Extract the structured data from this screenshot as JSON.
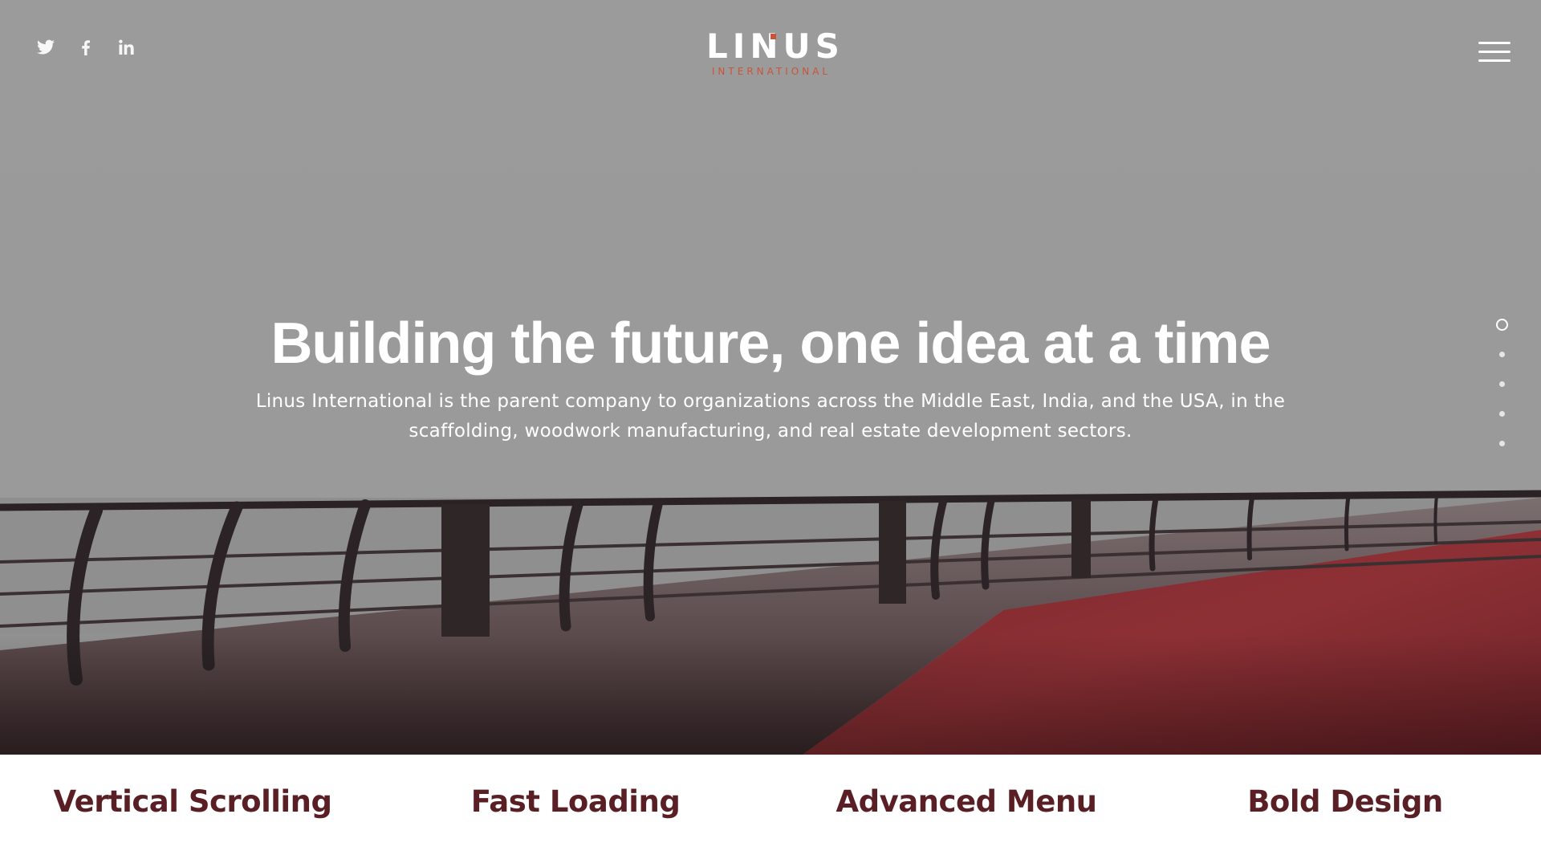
{
  "header": {
    "logo": {
      "word": "LINUS",
      "sub": "INTERNATIONAL"
    },
    "social": [
      {
        "name": "twitter",
        "icon": "twitter-icon"
      },
      {
        "name": "facebook",
        "icon": "facebook-icon"
      },
      {
        "name": "linkedin",
        "icon": "linkedin-icon"
      }
    ],
    "menu_icon": "hamburger-menu-icon"
  },
  "hero": {
    "heading": "Building the future, one idea at a time",
    "subheading": "Linus International is the parent company to organizations across the Middle East, India, and the USA, in the scaffolding, woodwork manufacturing, and real estate development sectors.",
    "slide_count": 5,
    "active_slide": 1
  },
  "features": [
    {
      "label": "Vertical Scrolling"
    },
    {
      "label": "Fast Loading"
    },
    {
      "label": "Advanced Menu"
    },
    {
      "label": "Bold Design"
    }
  ],
  "colors": {
    "sky": "#9a9a9a",
    "boardwalk": "#8a2f33",
    "accent": "#c8553a",
    "feature_text": "#5a1f24",
    "white": "#ffffff"
  }
}
